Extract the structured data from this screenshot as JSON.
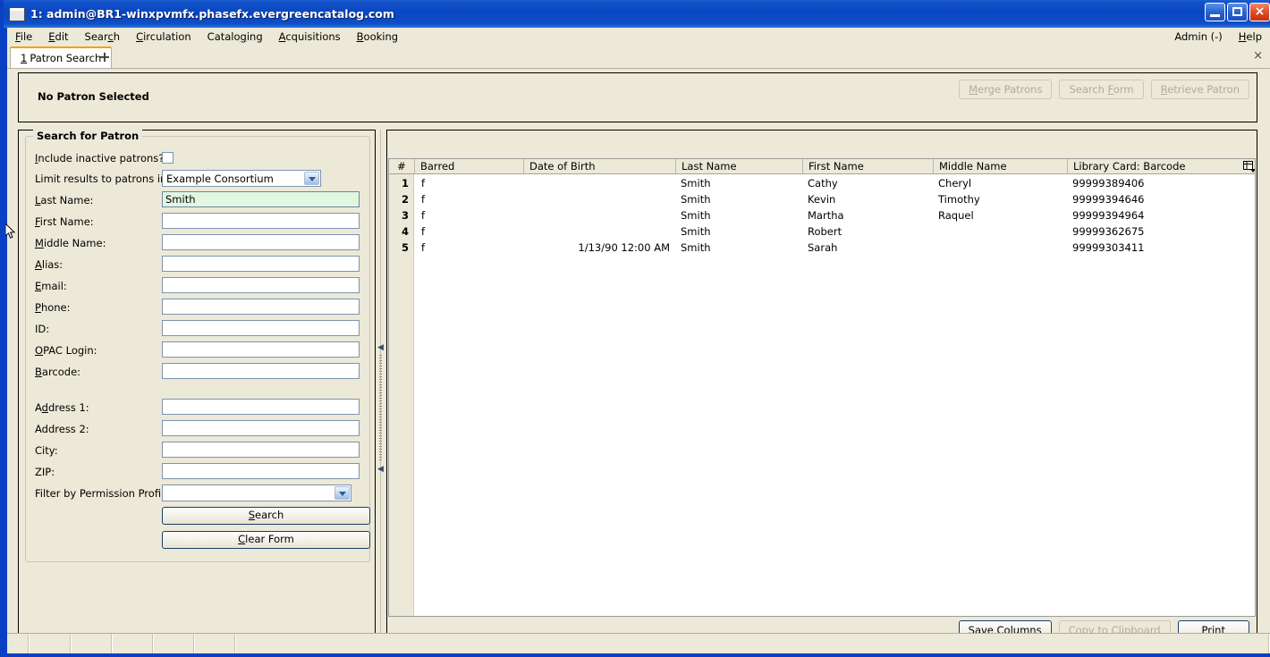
{
  "window": {
    "title": "1: admin@BR1-winxpvmfx.phasefx.evergreencatalog.com",
    "icon": "window-icon",
    "controls": {
      "minimize": "minimize-icon",
      "maximize": "maximize-icon",
      "close": "close-icon"
    }
  },
  "menubar": {
    "items": [
      {
        "label": "File",
        "accel": "F"
      },
      {
        "label": "Edit",
        "accel": "E"
      },
      {
        "label": "Search",
        "accel": "c"
      },
      {
        "label": "Circulation",
        "accel": "C"
      },
      {
        "label": "Cataloging",
        "accel": "g"
      },
      {
        "label": "Acquisitions",
        "accel": "A"
      },
      {
        "label": "Booking",
        "accel": "B"
      }
    ],
    "right_items": [
      {
        "label": "Admin (-)",
        "accel": ""
      },
      {
        "label": "Help",
        "accel": "H"
      }
    ]
  },
  "tabs": {
    "active": {
      "number": "1",
      "label": "Patron Search"
    },
    "new_tab_label": "+",
    "close_label": "×"
  },
  "patron_header": {
    "title": "No Patron Selected",
    "buttons": [
      {
        "label": "Merge Patrons",
        "accel": "M",
        "enabled": false
      },
      {
        "label": "Search Form",
        "accel": "F",
        "enabled": false
      },
      {
        "label": "Retrieve Patron",
        "accel": "R",
        "enabled": false
      }
    ]
  },
  "search_form": {
    "legend": "Search for Patron",
    "fields": [
      {
        "name": "include-inactive",
        "label": "Include inactive patrons?",
        "accel": "I",
        "type": "checkbox",
        "checked": false
      },
      {
        "name": "limit-org",
        "label": "Limit results to patrons in",
        "accel": "",
        "type": "combo",
        "value": "Example Consortium"
      },
      {
        "name": "last-name",
        "label": "Last Name:",
        "accel": "L",
        "type": "text",
        "value": "Smith",
        "focused": true
      },
      {
        "name": "first-name",
        "label": "First Name:",
        "accel": "F",
        "type": "text",
        "value": ""
      },
      {
        "name": "middle-name",
        "label": "Middle Name:",
        "accel": "M",
        "type": "text",
        "value": ""
      },
      {
        "name": "alias",
        "label": "Alias:",
        "accel": "A",
        "type": "text",
        "value": ""
      },
      {
        "name": "email",
        "label": "Email:",
        "accel": "E",
        "type": "text",
        "value": ""
      },
      {
        "name": "phone",
        "label": "Phone:",
        "accel": "P",
        "type": "text",
        "value": ""
      },
      {
        "name": "id",
        "label": "ID:",
        "accel": "",
        "type": "text",
        "value": ""
      },
      {
        "name": "opac-login",
        "label": "OPAC Login:",
        "accel": "O",
        "type": "text",
        "value": ""
      },
      {
        "name": "barcode",
        "label": "Barcode:",
        "accel": "B",
        "type": "text",
        "value": ""
      },
      {
        "name": "address-1",
        "label": "Address 1:",
        "accel": "d",
        "type": "text",
        "value": ""
      },
      {
        "name": "address-2",
        "label": "Address 2:",
        "accel": "",
        "type": "text",
        "value": ""
      },
      {
        "name": "city",
        "label": "City:",
        "accel": "",
        "type": "text",
        "value": ""
      },
      {
        "name": "zip",
        "label": "ZIP:",
        "accel": "",
        "type": "text",
        "value": ""
      },
      {
        "name": "permission-profile",
        "label": "Filter by Permission Profile:",
        "accel": "",
        "type": "combo",
        "value": ""
      }
    ],
    "search_button": {
      "label": "Search",
      "accel": "S"
    },
    "clear_button": {
      "label": "Clear Form",
      "accel": "C"
    }
  },
  "results": {
    "columns": [
      "#",
      "Barred",
      "Date of Birth",
      "Last Name",
      "First Name",
      "Middle Name",
      "Library Card: Barcode"
    ],
    "column_picker_icon": "column-picker-icon",
    "rows": [
      {
        "num": "1",
        "barred": "f",
        "dob": "",
        "last": "Smith",
        "first": "Cathy",
        "middle": "Cheryl",
        "barcode": "99999389406"
      },
      {
        "num": "2",
        "barred": "f",
        "dob": "",
        "last": "Smith",
        "first": "Kevin",
        "middle": "Timothy",
        "barcode": "99999394646"
      },
      {
        "num": "3",
        "barred": "f",
        "dob": "",
        "last": "Smith",
        "first": "Martha",
        "middle": "Raquel",
        "barcode": "99999394964"
      },
      {
        "num": "4",
        "barred": "f",
        "dob": "",
        "last": "Smith",
        "first": "Robert",
        "middle": "",
        "barcode": "99999362675"
      },
      {
        "num": "5",
        "barred": "f",
        "dob": "1/13/90 12:00 AM",
        "last": "Smith",
        "first": "Sarah",
        "middle": "",
        "barcode": "99999303411"
      }
    ],
    "buttons": [
      {
        "label": "Save Columns",
        "enabled": true,
        "default": true
      },
      {
        "label": "Copy to Clipboard",
        "enabled": false,
        "default": false
      },
      {
        "label": "Print",
        "enabled": true,
        "default": true
      }
    ]
  },
  "statusbar": {
    "segments": [
      "",
      "",
      "",
      "",
      "",
      "",
      ""
    ]
  },
  "colors": {
    "titlebar_blue": "#0a46c2",
    "window_bg": "#ece9d8",
    "tab_accent": "#f3a30a",
    "focused_field_bg": "#e2f7e0",
    "grid_bg": "#ffffff"
  }
}
